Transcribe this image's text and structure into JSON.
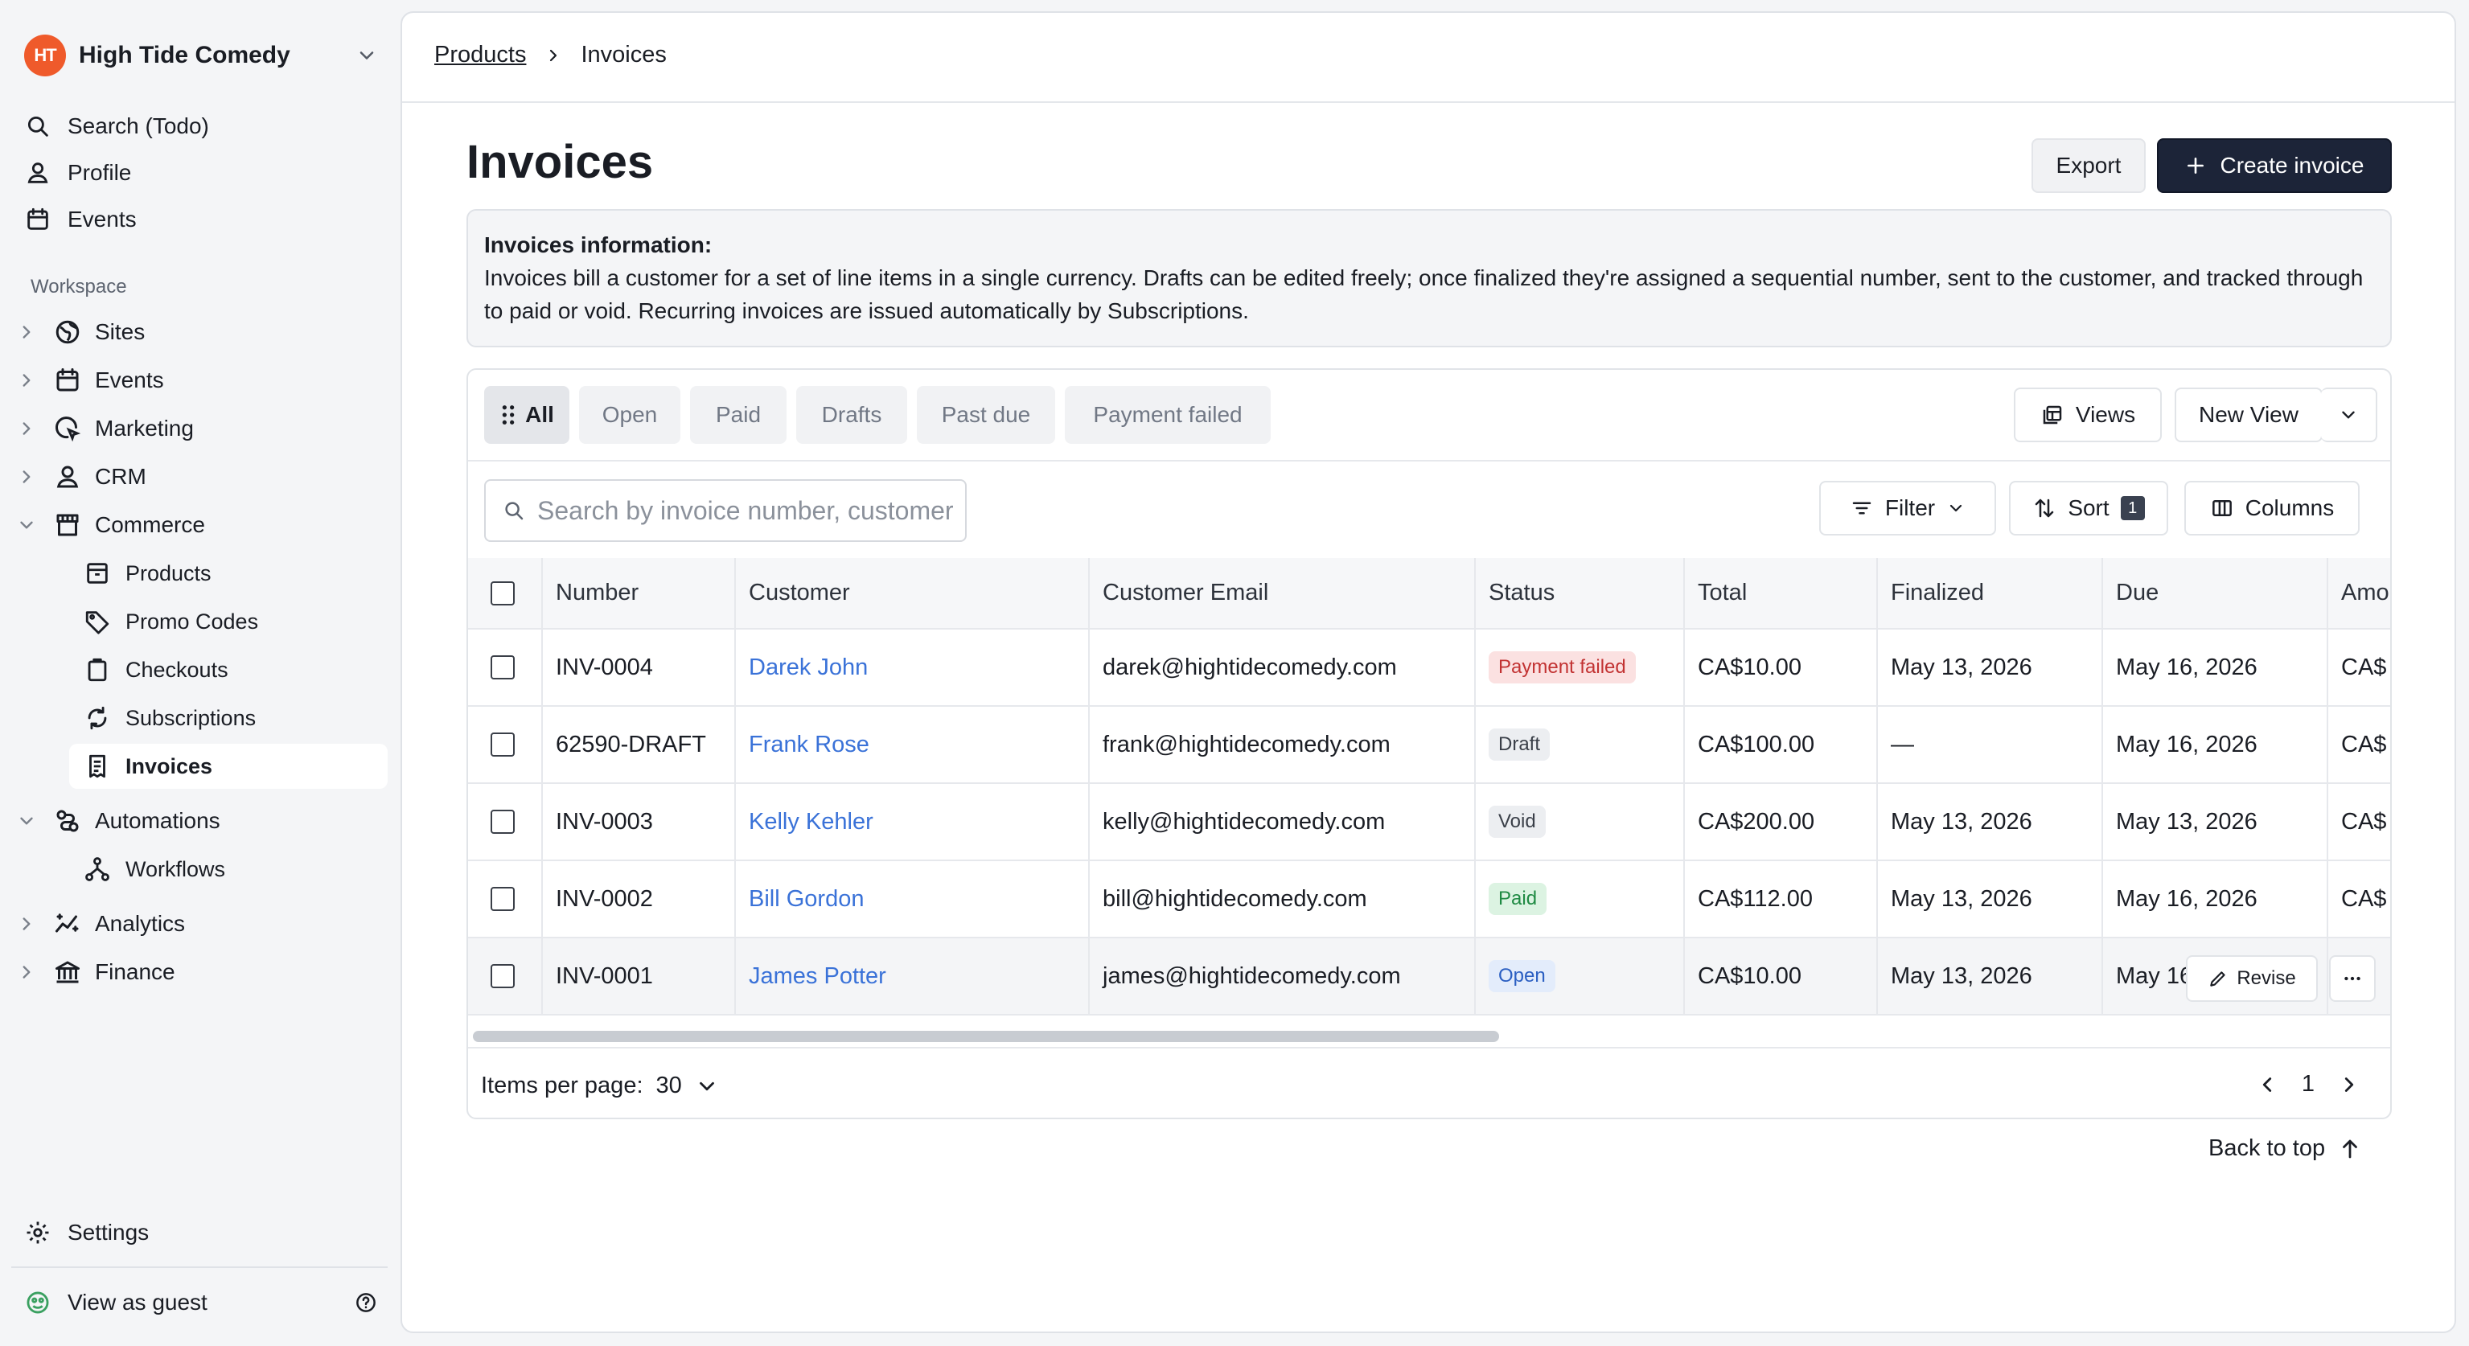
{
  "org": {
    "name": "High Tide Comedy",
    "logo_text": "HT"
  },
  "nav": {
    "search": "Search (Todo)",
    "profile": "Profile",
    "events": "Events",
    "workspace_label": "Workspace",
    "tree": [
      {
        "label": "Sites",
        "icon": "globe-icon"
      },
      {
        "label": "Events",
        "icon": "calendar-icon"
      },
      {
        "label": "Marketing",
        "icon": "marketing-icon"
      },
      {
        "label": "CRM",
        "icon": "user-icon"
      },
      {
        "label": "Commerce",
        "icon": "store-icon"
      },
      {
        "label": "Automations",
        "icon": "automations-icon"
      },
      {
        "label": "Analytics",
        "icon": "analytics-icon"
      },
      {
        "label": "Finance",
        "icon": "bank-icon"
      }
    ],
    "commerce_children": [
      {
        "label": "Products",
        "icon": "box-icon"
      },
      {
        "label": "Promo Codes",
        "icon": "tag-icon"
      },
      {
        "label": "Checkouts",
        "icon": "clipboard-icon"
      },
      {
        "label": "Subscriptions",
        "icon": "refresh-icon"
      },
      {
        "label": "Invoices",
        "icon": "receipt-icon"
      }
    ],
    "automation_children": [
      {
        "label": "Workflows",
        "icon": "workflow-icon"
      }
    ],
    "settings": "Settings",
    "view_as_guest": "View as guest"
  },
  "breadcrumb": {
    "parent": "Products",
    "current": "Invoices"
  },
  "page": {
    "title": "Invoices",
    "export_label": "Export",
    "create_label": "Create invoice"
  },
  "info": {
    "heading": "Invoices information:",
    "body": "Invoices bill a customer for a set of line items in a single currency. Drafts can be edited freely; once finalized they're assigned a sequential number, sent to the customer, and tracked through to paid or void. Recurring invoices are issued automatically by Subscriptions."
  },
  "tabs": [
    "All",
    "Open",
    "Paid",
    "Drafts",
    "Past due",
    "Payment failed"
  ],
  "toolbar": {
    "views": "Views",
    "new_view": "New View",
    "filter": "Filter",
    "sort": "Sort",
    "sort_count": "1",
    "columns": "Columns",
    "search_placeholder": "Search by invoice number, customer"
  },
  "table": {
    "columns": [
      "Number",
      "Customer",
      "Customer Email",
      "Status",
      "Total",
      "Finalized",
      "Due",
      "Amo"
    ],
    "rows": [
      {
        "number": "INV-0004",
        "customer": "Darek John",
        "email": "darek@hightidecomedy.com",
        "status": "Payment failed",
        "total": "CA$10.00",
        "finalized": "May 13, 2026",
        "due": "May 16, 2026",
        "amount": "CA$"
      },
      {
        "number": "62590-DRAFT",
        "customer": "Frank Rose",
        "email": "frank@hightidecomedy.com",
        "status": "Draft",
        "total": "CA$100.00",
        "finalized": "—",
        "due": "May 16, 2026",
        "amount": "CA$"
      },
      {
        "number": "INV-0003",
        "customer": "Kelly Kehler",
        "email": "kelly@hightidecomedy.com",
        "status": "Void",
        "total": "CA$200.00",
        "finalized": "May 13, 2026",
        "due": "May 13, 2026",
        "amount": "CA$"
      },
      {
        "number": "INV-0002",
        "customer": "Bill Gordon",
        "email": "bill@hightidecomedy.com",
        "status": "Paid",
        "total": "CA$112.00",
        "finalized": "May 13, 2026",
        "due": "May 16, 2026",
        "amount": "CA$"
      },
      {
        "number": "INV-0001",
        "customer": "James Potter",
        "email": "james@hightidecomedy.com",
        "status": "Open",
        "total": "CA$10.00",
        "finalized": "May 13, 2026",
        "due": "May 16, 2026",
        "amount": "$"
      }
    ],
    "row_action_revise": "Revise"
  },
  "pagination": {
    "items_per_page_label": "Items per page:",
    "items_per_page": "30",
    "page": "1"
  },
  "back_to_top": "Back to top",
  "colors": {
    "primary": "#1c2438",
    "link": "#3a72d8",
    "org_logo": "#ef5a2b"
  }
}
